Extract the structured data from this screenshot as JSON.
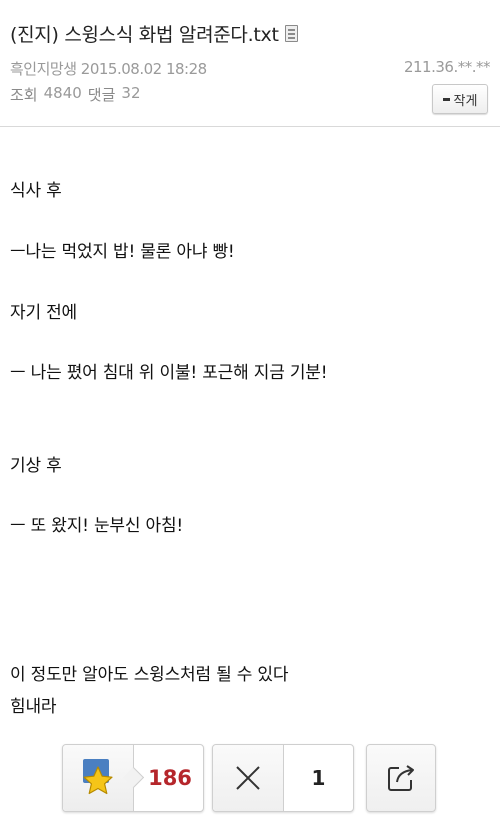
{
  "header": {
    "title": "(진지) 스윙스식 화법 알려준다.txt",
    "author": "흑인지망생",
    "datetime": "2015.08.02 18:28",
    "ip": "211.36.**.**",
    "views_label": "조회",
    "views": "4840",
    "comments_label": "댓글",
    "comments": "32",
    "author_button_label": "작게"
  },
  "content": {
    "lines": [
      "식사 후",
      "ㅡ나는 먹었지 밥! 물론 아냐 빵!",
      "자기 전에",
      "ㅡ 나는 폈어 침대 위 이불! 포근해 지금 기분!",
      "기상 후",
      "ㅡ 또 왔지! 눈부신 아침!",
      "이 정도만 알아도 스윙스처럼 될 수 있다",
      "힘내라"
    ]
  },
  "actions": {
    "recommend_count": "186",
    "dislike_count": "1"
  },
  "icons": {
    "file": "file-icon",
    "recommend": "star-icon",
    "dislike": "x-icon",
    "share": "share-icon"
  },
  "colors": {
    "recommend_count": "#b5262b",
    "star_fill": "#f5c518",
    "star_bg": "#4a7fc1"
  }
}
